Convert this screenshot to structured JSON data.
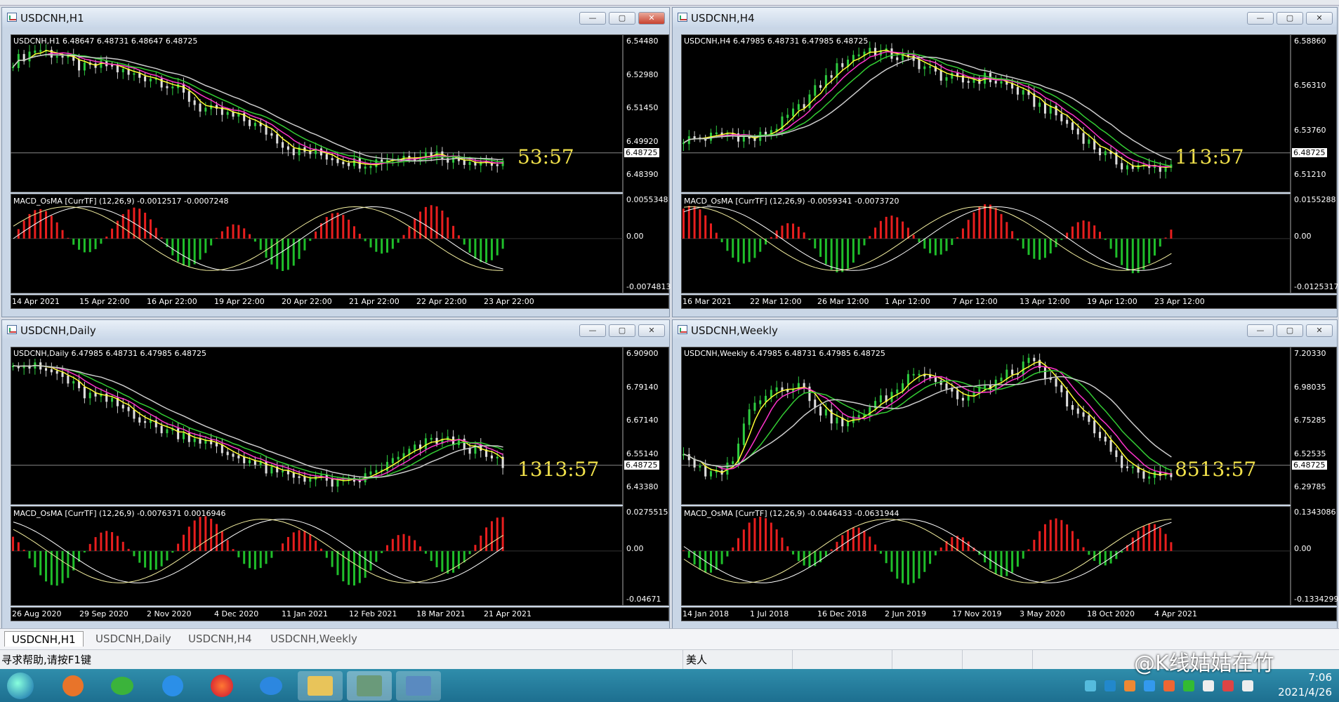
{
  "tabs": [
    "USDCNH,H1",
    "USDCNH,Daily",
    "USDCNH,H4",
    "USDCNH,Weekly"
  ],
  "status": {
    "help": "寻求帮助,请按F1键",
    "seg2": "美人"
  },
  "clock": {
    "time": "7:06",
    "date": "2021/4/26"
  },
  "watermark": "@K线姑姑在竹",
  "windows": [
    {
      "title": "USDCNH,H1",
      "info": "USDCNH,H1  6.48647 6.48731 6.48647 6.48725",
      "countdown": "53:57",
      "price_box": "6.48725",
      "price_labels": [
        "6.54480",
        "6.52980",
        "6.51450",
        "6.49920",
        "6.48390"
      ],
      "macd_info": "MACD_OsMA [CurrTF] (12,26,9) -0.0012517 -0.0007248",
      "macd_labels": [
        "0.0055348",
        "0.00",
        "-0.0074813"
      ],
      "time_labels": [
        "14 Apr 2021",
        "15 Apr 22:00",
        "16 Apr 22:00",
        "19 Apr 22:00",
        "20 Apr 22:00",
        "21 Apr 22:00",
        "22 Apr 22:00",
        "23 Apr 22:00"
      ]
    },
    {
      "title": "USDCNH,H4",
      "info": "USDCNH,H4  6.47985 6.48731 6.47985 6.48725",
      "countdown": "113:57",
      "price_box": "6.48725",
      "price_labels": [
        "6.58860",
        "6.56310",
        "6.53760",
        "6.51210"
      ],
      "macd_info": "MACD_OsMA [CurrTF] (12,26,9) -0.0059341 -0.0073720",
      "macd_labels": [
        "0.0155288",
        "0.00",
        "-0.0125317"
      ],
      "time_labels": [
        "16 Mar 2021",
        "22 Mar 12:00",
        "26 Mar 12:00",
        "1 Apr 12:00",
        "7 Apr 12:00",
        "13 Apr 12:00",
        "19 Apr 12:00",
        "23 Apr 12:00"
      ]
    },
    {
      "title": "USDCNH,Daily",
      "info": "USDCNH,Daily  6.47985 6.48731 6.47985 6.48725",
      "countdown": "1313:57",
      "price_box": "6.48725",
      "price_labels": [
        "6.90900",
        "6.79140",
        "6.67140",
        "6.55140",
        "6.43380"
      ],
      "macd_info": "MACD_OsMA [CurrTF] (12,26,9) -0.0076371 0.0016946",
      "macd_labels": [
        "0.0275515",
        "0.00",
        "-0.04671"
      ],
      "time_labels": [
        "26 Aug 2020",
        "29 Sep 2020",
        "2 Nov 2020",
        "4 Dec 2020",
        "11 Jan 2021",
        "12 Feb 2021",
        "18 Mar 2021",
        "21 Apr 2021"
      ]
    },
    {
      "title": "USDCNH,Weekly",
      "info": "USDCNH,Weekly  6.47985 6.48731 6.47985 6.48725",
      "countdown": "8513:57",
      "price_box": "6.48725",
      "price_labels": [
        "7.20330",
        "6.98035",
        "6.75285",
        "6.52535",
        "6.29785"
      ],
      "macd_info": "MACD_OsMA [CurrTF] (12,26,9) -0.0446433 -0.0631944",
      "macd_labels": [
        "0.1343086",
        "0.00",
        "-0.1334299"
      ],
      "time_labels": [
        "14 Jan 2018",
        "1 Jul 2018",
        "16 Dec 2018",
        "2 Jun 2019",
        "17 Nov 2019",
        "3 May 2020",
        "18 Oct 2020",
        "4 Apr 2021"
      ]
    }
  ]
}
